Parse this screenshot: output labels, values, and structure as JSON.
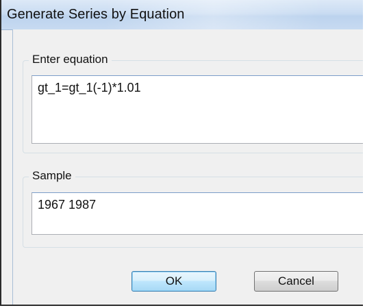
{
  "dialog": {
    "title": "Generate Series by Equation"
  },
  "equation": {
    "label": "Enter equation",
    "value": "gt_1=gt_1(-1)*1.01"
  },
  "sample": {
    "label": "Sample",
    "value": "1967 1987"
  },
  "buttons": {
    "ok_label": "OK",
    "cancel_label": "Cancel"
  }
}
